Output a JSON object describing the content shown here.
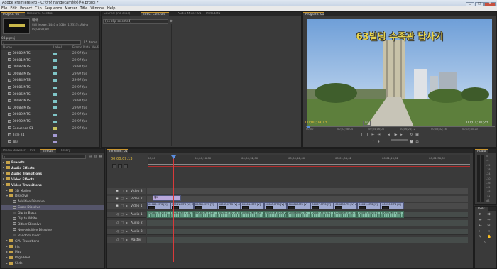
{
  "window": {
    "title": "Adobe Premiere Pro - C:\\바탕 handycam촬영본4.prproj *",
    "controls": [
      "_",
      "□",
      "✕"
    ]
  },
  "menu": [
    "File",
    "Edit",
    "Project",
    "Clip",
    "Sequence",
    "Marker",
    "Title",
    "Window",
    "Help"
  ],
  "project": {
    "tabs": [
      "Project: 04",
      "Resource Central"
    ],
    "preview_name": "웨바",
    "preview_info": "Still Image, 1440 x 1080 (1.3333), Alpha",
    "preview_duration": "00;00;05;00",
    "bin_label": "04.prproj",
    "items_count": "15 Items",
    "columns": [
      "Name",
      "Label",
      "Frame Rate",
      "Medi"
    ],
    "rows": [
      {
        "name": "00080.MTS",
        "rate": "29.97 fps",
        "type": "clip",
        "color": "#7fc5c7"
      },
      {
        "name": "00081.MTS",
        "rate": "29.97 fps",
        "type": "clip",
        "color": "#7fc5c7"
      },
      {
        "name": "00082.MTS",
        "rate": "29.97 fps",
        "type": "clip",
        "color": "#7fc5c7"
      },
      {
        "name": "00083.MTS",
        "rate": "29.97 fps",
        "type": "clip",
        "color": "#7fc5c7"
      },
      {
        "name": "00084.MTS",
        "rate": "29.97 fps",
        "type": "clip",
        "color": "#7fc5c7"
      },
      {
        "name": "00085.MTS",
        "rate": "29.97 fps",
        "type": "clip",
        "color": "#7fc5c7"
      },
      {
        "name": "00086.MTS",
        "rate": "29.97 fps",
        "type": "clip",
        "color": "#7fc5c7"
      },
      {
        "name": "00087.MTS",
        "rate": "29.97 fps",
        "type": "clip",
        "color": "#7fc5c7"
      },
      {
        "name": "00088.MTS",
        "rate": "29.97 fps",
        "type": "clip",
        "color": "#7fc5c7"
      },
      {
        "name": "00089.MTS",
        "rate": "29.97 fps",
        "type": "clip",
        "color": "#7fc5c7"
      },
      {
        "name": "00090.MTS",
        "rate": "29.97 fps",
        "type": "clip",
        "color": "#7fc5c7"
      },
      {
        "name": "Sequence 01",
        "rate": "29.97 fps",
        "type": "seq",
        "color": "#c8c35e"
      },
      {
        "name": "Title 24",
        "rate": "",
        "type": "title",
        "color": "#a49ad2"
      },
      {
        "name": "웨바",
        "rate": "",
        "type": "still",
        "color": "#a49ad2"
      }
    ]
  },
  "source": {
    "tabs": [
      "Source: (no clips)",
      "Effect Controls",
      "Audio Mixer: 01",
      "Metadata"
    ],
    "dropdown": "(no clip selected)"
  },
  "program": {
    "tabs": [
      "Program: 01"
    ],
    "overlay_title": "63빌딩  수족관  답사기",
    "timecode_current": "00;00;09;13",
    "timecode_duration": "00;01;30;23",
    "fit_label": "Fit",
    "ruler": [
      "00;00",
      "00;02;08;04",
      "00;04;16;08",
      "00;06;24;12",
      "00;08;32;16",
      "00;10;40;20"
    ]
  },
  "effects": {
    "tabs": [
      "Media Browser",
      "Info",
      "Effects",
      "History"
    ],
    "items": [
      {
        "label": "Presets",
        "kind": "folder",
        "level": 0,
        "expanded": false
      },
      {
        "label": "Audio Effects",
        "kind": "folder",
        "level": 0,
        "expanded": false
      },
      {
        "label": "Audio Transitions",
        "kind": "folder",
        "level": 0,
        "expanded": false
      },
      {
        "label": "Video Effects",
        "kind": "folder",
        "level": 0,
        "expanded": false
      },
      {
        "label": "Video Transitions",
        "kind": "folder",
        "level": 0,
        "expanded": true
      },
      {
        "label": "3D Motion",
        "kind": "folder",
        "level": 1,
        "expanded": false
      },
      {
        "label": "Dissolve",
        "kind": "folder",
        "level": 1,
        "expanded": true
      },
      {
        "label": "Additive Dissolve",
        "kind": "effect",
        "level": 2
      },
      {
        "label": "Cross Dissolve",
        "kind": "effect",
        "level": 2,
        "selected": true
      },
      {
        "label": "Dip to Black",
        "kind": "effect",
        "level": 2
      },
      {
        "label": "Dip to White",
        "kind": "effect",
        "level": 2
      },
      {
        "label": "Dither Dissolve",
        "kind": "effect",
        "level": 2
      },
      {
        "label": "Non-Additive Dissolve",
        "kind": "effect",
        "level": 2
      },
      {
        "label": "Random Invert",
        "kind": "effect",
        "level": 2
      },
      {
        "label": "GPU Transitions",
        "kind": "folder",
        "level": 1,
        "expanded": false
      },
      {
        "label": "Iris",
        "kind": "folder",
        "level": 1,
        "expanded": false
      },
      {
        "label": "Map",
        "kind": "folder",
        "level": 1,
        "expanded": false
      },
      {
        "label": "Page Peel",
        "kind": "folder",
        "level": 1,
        "expanded": false
      },
      {
        "label": "Slide",
        "kind": "folder",
        "level": 1,
        "expanded": false
      }
    ]
  },
  "timeline": {
    "tabs": [
      "Timeline: 01"
    ],
    "timecode": "00;00;09;13",
    "ruler": [
      "00;00",
      "00;00;16;00",
      "00;00;32;00",
      "00;00;48;00",
      "00;01;04;02",
      "00;01;20;02",
      "00;01;36;02"
    ],
    "tracks": [
      "Video 3",
      "Video 2",
      "Video 1",
      "Audio 1",
      "Audio 2",
      "Audio 3",
      "Master"
    ],
    "title_clip": "웨바",
    "video_clips": [
      "00080.MTS [V]",
      "00081.MTS [V] Opacity:O",
      "00082.MTS [V]",
      "00083.MTS [V] city:",
      "00084.MTS [V]",
      "00085.MTS [V] Opacity",
      "00086.MTS [V]",
      "00087.MTS [V]",
      "00088.MTS [V] city:Opacity",
      "00089.MTS [V]",
      "00090.MTS [V]"
    ],
    "audio_clips": [
      "00080.MTS [A]",
      "00081.MTS [A] Volume:L",
      "00082.MTS [A]",
      "00083.MTS [A] ne:L",
      "00084.MTS [A]",
      "00085.MTS [A] Volume",
      "00086.MTS [A]",
      "00087.MTS [A]",
      "00088.MTS [A] olume:Level",
      "00089.MTS [A]",
      "00090.MTS [A]"
    ]
  },
  "audio_meter": {
    "tab": "Audio",
    "scale": [
      "0",
      "-6",
      "-12",
      "-18",
      "-24",
      "-30",
      "-36",
      "-42",
      "-48",
      "-54",
      "dB"
    ]
  },
  "tools": {
    "tab": "Tools"
  }
}
